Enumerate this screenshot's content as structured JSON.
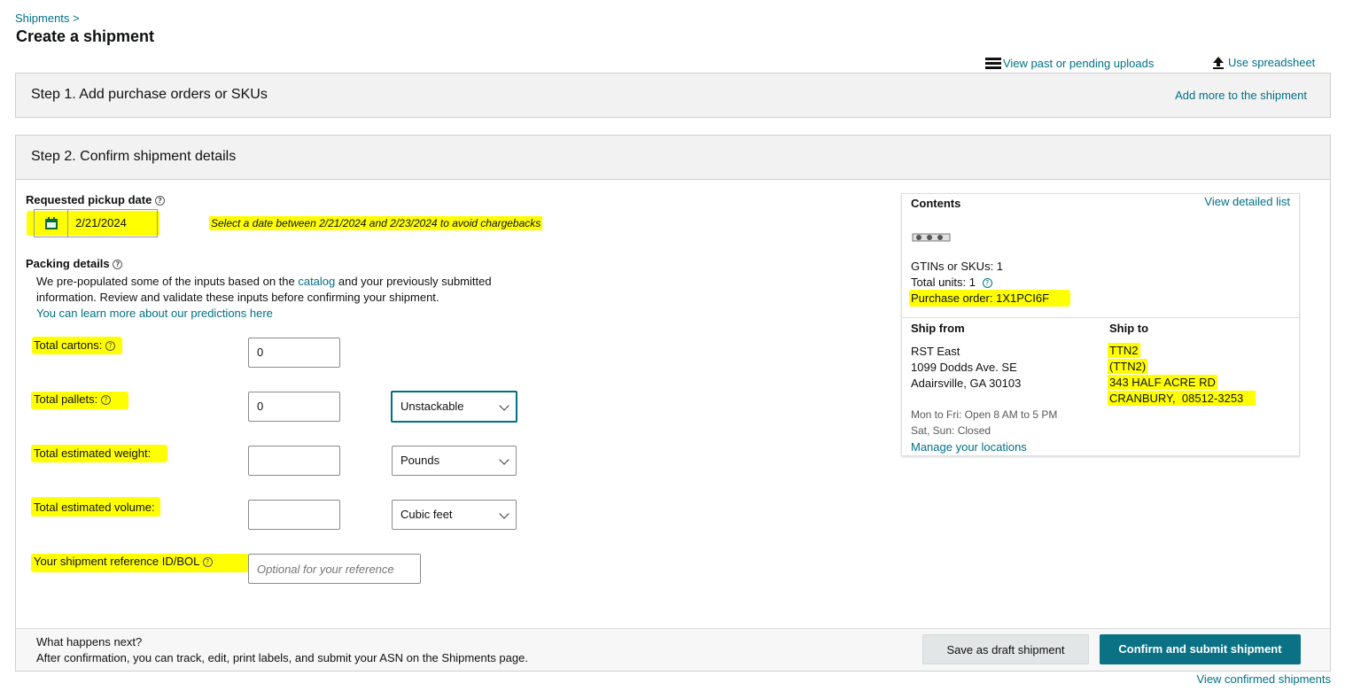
{
  "breadcrumb": {
    "link": "Shipments",
    "sep": ">"
  },
  "page_title": "Create a shipment",
  "top_actions": {
    "past_uploads": "View past or pending uploads",
    "spreadsheet": "Use spreadsheet"
  },
  "step1": {
    "title": "Step 1. Add purchase orders or SKUs",
    "add_more": "Add more to the shipment"
  },
  "step2": {
    "title": "Step 2. Confirm shipment details"
  },
  "pickup": {
    "label": "Requested pickup date",
    "date": "2/21/2024",
    "note": "Select a date between 2/21/2024 and 2/23/2024 to avoid chargebacks"
  },
  "packing": {
    "title": "Packing details",
    "desc_before": "We pre-populated some of the inputs based on the ",
    "catalog_link": "catalog",
    "desc_after": " and your previously submitted",
    "desc_line2": "information. Review and validate these inputs before confirming your shipment.",
    "learn_link": "You can learn more about our predictions here"
  },
  "fields": {
    "cartons_label": "Total cartons:",
    "cartons_value": "0",
    "pallets_label": "Total pallets:",
    "pallets_value": "0",
    "pallet_type": "Unstackable",
    "weight_label": "Total estimated weight:",
    "weight_value": "",
    "weight_unit": "Pounds",
    "volume_label": "Total estimated volume:",
    "volume_value": "",
    "volume_unit": "Cubic feet",
    "reference_label": "Your shipment reference ID/BOL",
    "reference_placeholder": "Optional for your reference"
  },
  "contents": {
    "title": "Contents",
    "view_list": "View detailed list",
    "gtins": "GTINs or SKUs: 1",
    "units": "Total units: 1",
    "po": "Purchase order: 1X1PCI6F"
  },
  "ship_from": {
    "title": "Ship from",
    "name": "RST East",
    "street": "1099 Dodds Ave. SE",
    "city": "Adairsville, GA 30103",
    "hours1": "Mon to Fri: Open 8 AM to 5 PM",
    "hours2": "Sat, Sun: Closed",
    "manage": "Manage your locations"
  },
  "ship_to": {
    "title": "Ship to",
    "line1": "TTN2",
    "line2": "(TTN2)",
    "line3": "343 HALF ACRE RD",
    "line4": "CRANBURY,  08512-3253"
  },
  "footer": {
    "question": "What happens next?",
    "info": "After confirmation, you can track, edit, print labels, and submit your ASN on the Shipments page.",
    "draft_button": "Save as draft shipment",
    "confirm_button": "Confirm and submit shipment",
    "view_confirmed": "View confirmed shipments"
  },
  "colors": {
    "link": "#007185",
    "primary_button": "#0b7285",
    "highlight": "#ffff00"
  }
}
